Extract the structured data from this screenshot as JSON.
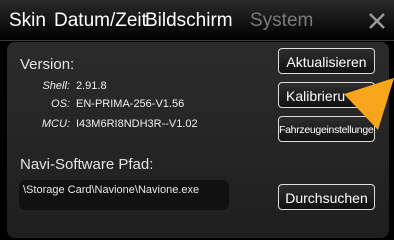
{
  "tabs": [
    {
      "label": "Skin",
      "active": true
    },
    {
      "label": "Datum/Zeit",
      "active": true
    },
    {
      "label": "Bildschirm",
      "active": true
    },
    {
      "label": "System",
      "active": false
    }
  ],
  "version": {
    "title": "Version:",
    "rows": [
      {
        "key": "Shell:",
        "value": "2.91.8"
      },
      {
        "key": "OS:",
        "value": "EN-PRIMA-256-V1.56"
      },
      {
        "key": "MCU:",
        "value": "I43M6RI8NDH3R--V1.02"
      }
    ]
  },
  "navi": {
    "title": "Navi-Software Pfad:",
    "path": "\\Storage Card\\Navione\\Navione.exe"
  },
  "buttons": {
    "update": "Aktualisieren",
    "calibrate": "Kalibrieru",
    "vehicle_settings": "Fahrzeugeinstellungen",
    "browse": "Durchsuchen"
  },
  "icons": {
    "close": "close-icon",
    "pointer": "pointer-arrow-icon"
  },
  "colors": {
    "active_tab": "#ffffff",
    "inactive_tab": "#7a7a7a",
    "pointer": "#f7a61c"
  }
}
